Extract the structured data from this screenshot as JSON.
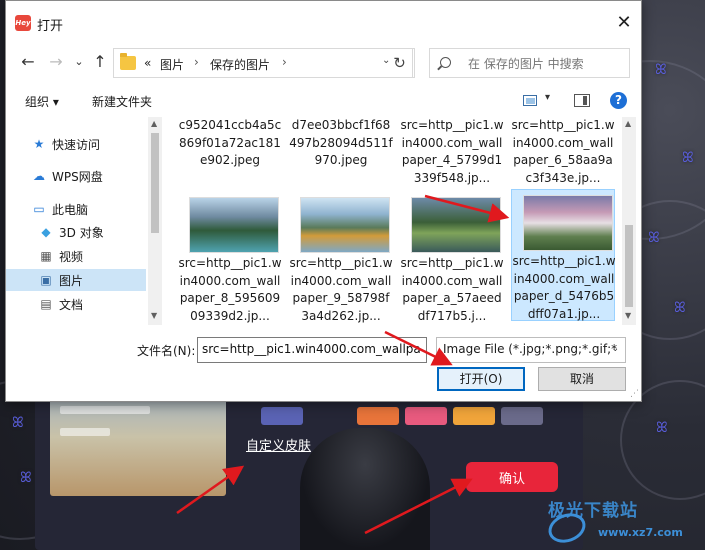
{
  "dialog": {
    "app_icon_text": "Hey",
    "title": "打开",
    "close_glyph": "✕"
  },
  "nav": {
    "back_glyph": "←",
    "forward_glyph": "→",
    "dropdown_glyph": "⌄",
    "up_glyph": "↑",
    "breadcrumb_prefix": "«",
    "breadcrumb": [
      "图片",
      "保存的图片"
    ],
    "crumb_sep": "›",
    "addr_dropdown_glyph": "⌄",
    "refresh_glyph": "↻",
    "search_placeholder": "在 保存的图片 中搜索"
  },
  "toolbar": {
    "organize_label": "组织 ▾",
    "new_folder_label": "新建文件夹",
    "view_dropdown_glyph": "▾",
    "help_glyph": "?"
  },
  "sidebar": {
    "items": [
      {
        "label": "快速访问",
        "icon": "star-icon",
        "glyph": "★"
      },
      {
        "label": "WPS网盘",
        "icon": "cloud-icon",
        "glyph": "☁"
      },
      {
        "label": "此电脑",
        "icon": "computer-icon",
        "glyph": "▭"
      },
      {
        "label": "3D 对象",
        "icon": "cube-icon",
        "glyph": "◆"
      },
      {
        "label": "视频",
        "icon": "video-icon",
        "glyph": "▦"
      },
      {
        "label": "图片",
        "icon": "picture-icon",
        "glyph": "▣"
      },
      {
        "label": "文档",
        "icon": "document-icon",
        "glyph": "▤"
      }
    ],
    "selected_index": 5,
    "scroll_up_glyph": "▲",
    "scroll_down_glyph": "▼"
  },
  "files": {
    "top_row": [
      "c952041ccb4a5c869f01a72ac181e902.jpeg",
      "d7ee03bbcf1f68497b28094d511f970.jpeg",
      "src=http__pic1.win4000.com_wallpaper_4_5799d1339f548.jp...",
      "src=http__pic1.win4000.com_wallpaper_6_58aa9ac3f343e.jp..."
    ],
    "bottom_row": [
      "src=http__pic1.win4000.com_wallpaper_8_59560909339d2.jp...",
      "src=http__pic1.win4000.com_wallpaper_9_58798f3a4d262.jp...",
      "src=http__pic1.win4000.com_wallpaper_a_57aeeddf717b5.j...",
      "src=http__pic1.win4000.com_wallpaper_d_5476b5dff07a1.jp..."
    ],
    "selected_index": 3,
    "scroll_up_glyph": "▲",
    "scroll_down_glyph": "▼"
  },
  "bottom": {
    "filename_label": "文件名(N):",
    "filename_value": "src=http__pic1.win4000.com_wallpa",
    "filetype_value": "Image File (*.jpg;*.png;*.gif;*",
    "filetype_dropdown_glyph": "⌄",
    "open_label": "打开(O)",
    "cancel_label": "取消",
    "resize_glyph": "⋰"
  },
  "background_app": {
    "custom_skin_label": "自定义皮肤",
    "confirm_label": "确认",
    "butterfly_glyph": "ꕤ",
    "watermark_text": "极光下载站",
    "watermark_url": "www.xz7.com",
    "swatch_colors": [
      "#5a63b4",
      "#e8743a",
      "#e85a7e",
      "#f0a43a",
      "#6a6a8a"
    ]
  },
  "colors": {
    "accent": "#0067c0",
    "selection": "#cce8ff",
    "confirm": "#e8253a",
    "annotation_arrow": "#e0191e"
  }
}
